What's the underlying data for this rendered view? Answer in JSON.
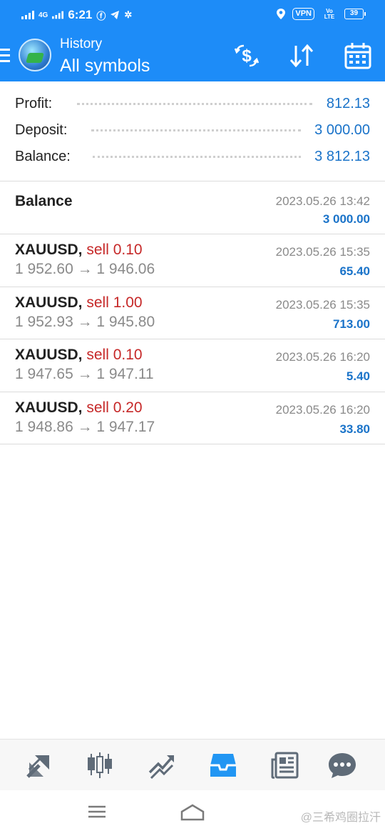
{
  "status_bar": {
    "network": "4G",
    "time": "6:21",
    "vpn": "VPN",
    "volte": "Vo LTE",
    "battery": "39"
  },
  "header": {
    "title": "History",
    "subtitle": "All symbols",
    "icons": [
      "currency-exchange-icon",
      "sort-icon",
      "calendar-icon"
    ]
  },
  "summary": {
    "profit_label": "Profit:",
    "profit_value": "812.13",
    "deposit_label": "Deposit:",
    "deposit_value": "3 000.00",
    "balance_label": "Balance:",
    "balance_value": "3 812.13"
  },
  "balance_entry": {
    "title": "Balance",
    "time": "2023.05.26 13:42",
    "amount": "3 000.00"
  },
  "deals": [
    {
      "symbol": "XAUUSD,",
      "side": "sell 0.10",
      "prices": "1 952.60 → 1 946.06",
      "time": "2023.05.26 15:35",
      "profit": "65.40"
    },
    {
      "symbol": "XAUUSD,",
      "side": "sell 1.00",
      "prices": "1 952.93 → 1 945.80",
      "time": "2023.05.26 15:35",
      "profit": "713.00"
    },
    {
      "symbol": "XAUUSD,",
      "side": "sell 0.10",
      "prices": "1 947.65 → 1 947.11",
      "time": "2023.05.26 16:20",
      "profit": "5.40"
    },
    {
      "symbol": "XAUUSD,",
      "side": "sell 0.20",
      "prices": "1 948.86 → 1 947.17",
      "time": "2023.05.26 16:20",
      "profit": "33.80"
    }
  ],
  "tabs": [
    "quotes-icon",
    "chart-icon",
    "trade-icon",
    "history-icon",
    "news-icon",
    "chat-icon"
  ],
  "active_tab": "history-icon",
  "watermark": "@三希鸡圈拉汗",
  "colors": {
    "app_bar": "#1d8cf8",
    "profit_blue": "#1a73c9",
    "sell_red": "#c62828",
    "muted_gray": "#8a8a8a",
    "active_tab": "#2196f3"
  }
}
